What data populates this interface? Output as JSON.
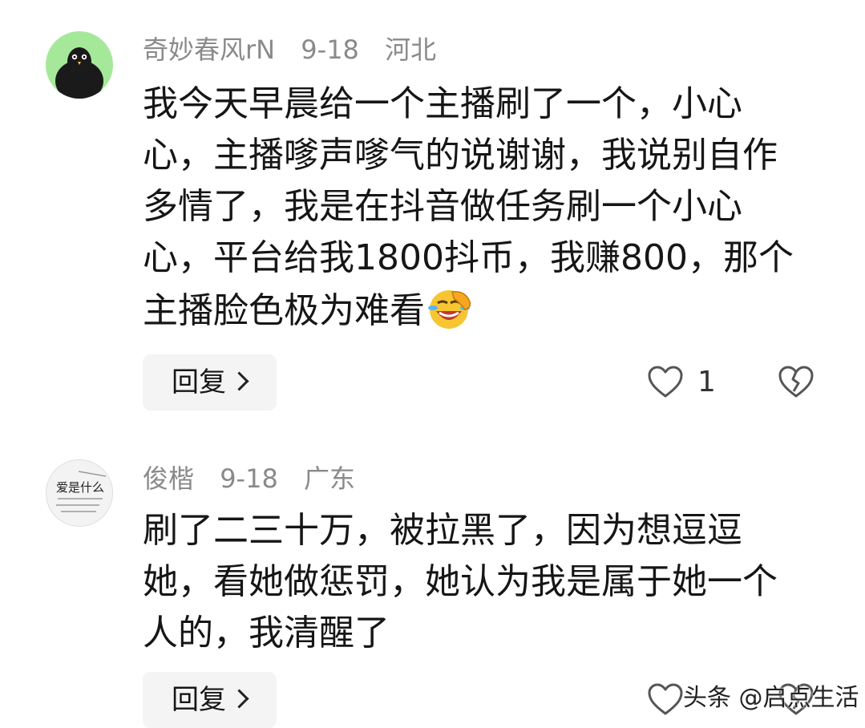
{
  "comments": [
    {
      "username": "奇妙春风rN",
      "date": "9-18",
      "location": "河北",
      "text": "我今天早晨给一个主播刷了一个，小心心，主播嗲声嗲气的说谢谢，我说别自作多情了，我是在抖音做任务刷一个小心心，平台给我1800抖币，我赚800，那个主播脸色极为难看",
      "emoji": "laughing-crying-face-emoji",
      "reply_label": "回复",
      "like_count": "1",
      "avatar": "black-bird-on-green-avatar"
    },
    {
      "username": "俊楷",
      "date": "9-18",
      "location": "广东",
      "text": "刷了二三十万，被拉黑了，因为想逗逗她，看她做惩罚，她认为我是属于她一个人的，我清醒了",
      "reply_label": "回复",
      "avatar": "handwriting-avatar",
      "avatar_text": "爱是什么"
    }
  ],
  "watermark": "头条 @启点生活",
  "colors": {
    "meta": "#8a8a8a",
    "text": "#161616",
    "button_bg": "#f4f4f4",
    "avatar1_bg": "#a6e89a"
  }
}
